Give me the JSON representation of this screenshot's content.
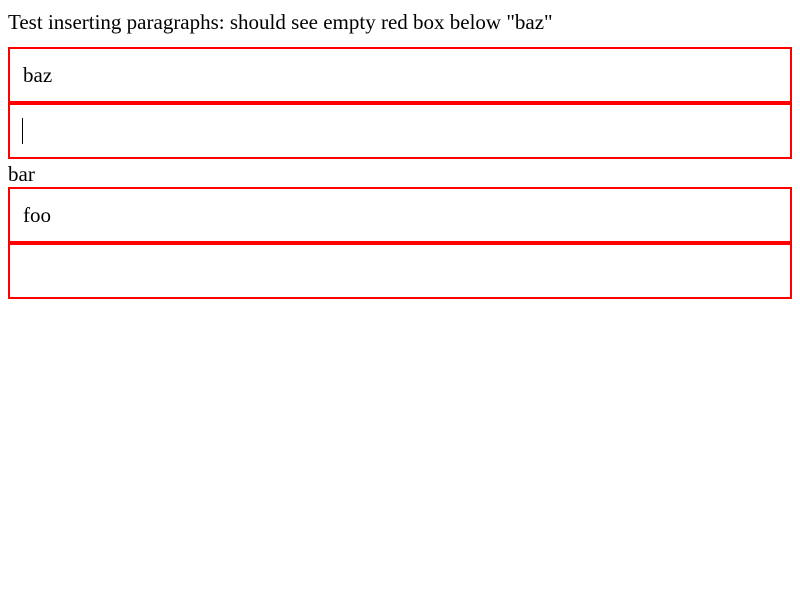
{
  "description": "Test inserting paragraphs: should see empty red box below \"baz\"",
  "boxes": {
    "first": {
      "text": "baz"
    },
    "second": {
      "text": ""
    },
    "third": {
      "text": "foo"
    },
    "fourth": {
      "text": ""
    }
  },
  "loose_text": "bar",
  "colors": {
    "box_border": "#ff0000",
    "text": "#000000",
    "background": "#ffffff"
  }
}
